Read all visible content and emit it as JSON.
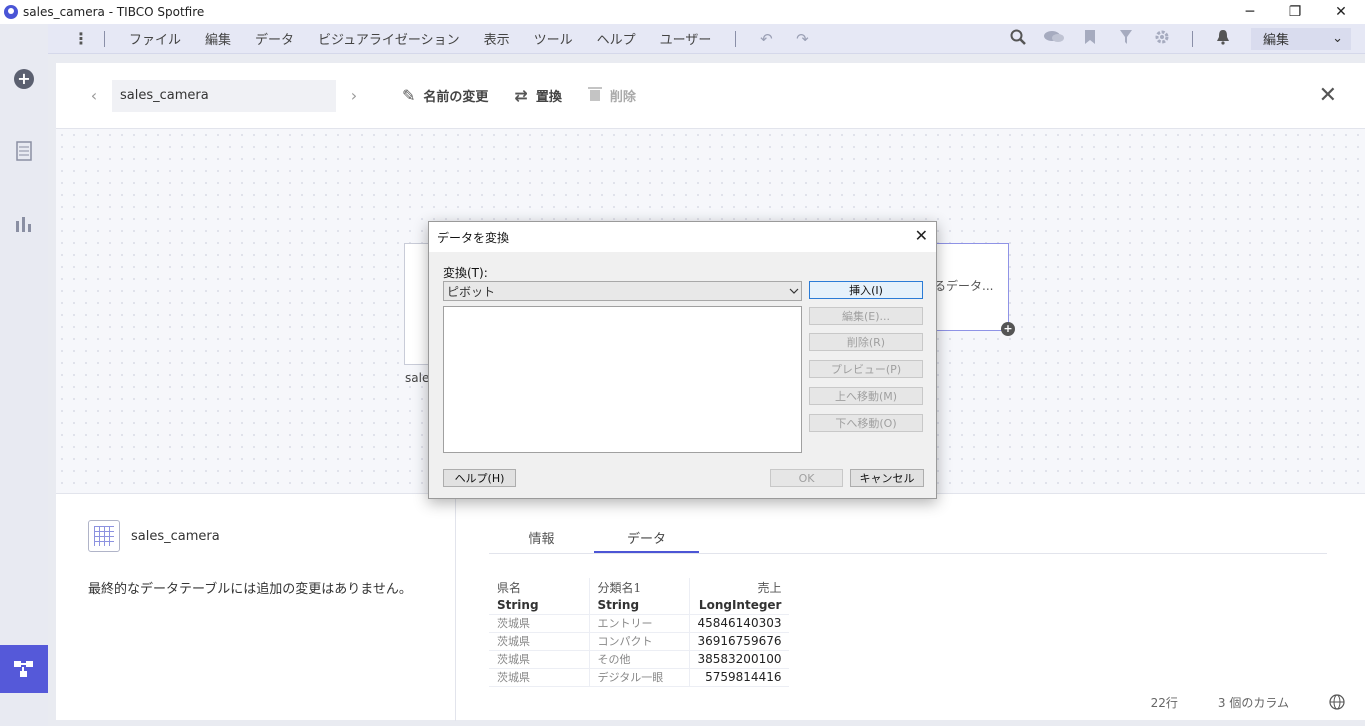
{
  "window": {
    "title": "sales_camera - TIBCO Spotfire",
    "min": "─",
    "restore": "❐",
    "close": "✕"
  },
  "menu": {
    "dots": "⋮",
    "items": [
      "ファイル",
      "編集",
      "データ",
      "ビジュアライゼーション",
      "表示",
      "ツール",
      "ヘルプ",
      "ユーザー"
    ],
    "undo": "↶",
    "redo": "↷",
    "mode": "編集",
    "mode_caret": "⌄"
  },
  "toolbar": {
    "prev": "‹",
    "next": "›",
    "table_name": "sales_camera",
    "rename": "名前の変更",
    "replace": "置換",
    "delete": "削除",
    "close": "✕"
  },
  "canvas": {
    "left_node_label": "sales",
    "right_node_label": "るデータ..."
  },
  "details": {
    "table_name": "sales_camera",
    "info_text": "最終的なデータテーブルには追加の変更はありません。",
    "tabs": [
      "情報",
      "データ"
    ],
    "columns": [
      {
        "name": "県名",
        "type": "String"
      },
      {
        "name": "分類名1",
        "type": "String"
      },
      {
        "name": "売上",
        "type": "LongInteger"
      }
    ],
    "rows": [
      [
        "茨城県",
        "エントリー",
        "45846140303"
      ],
      [
        "茨城県",
        "コンパクト",
        "36916759676"
      ],
      [
        "茨城県",
        "その他",
        "38583200100"
      ],
      [
        "茨城県",
        "デジタル一眼",
        "5759814416"
      ]
    ],
    "row_count": "22行",
    "column_count": "3 個のカラム"
  },
  "dialog": {
    "title": "データを変換",
    "transform_label": "変換(T):",
    "transform_value": "ピボット",
    "insert": "挿入(I)",
    "edit": "編集(E)...",
    "remove": "削除(R)",
    "preview": "プレビュー(P)",
    "move_up": "上へ移動(M)",
    "move_down": "下へ移動(O)",
    "help": "ヘルプ(H)",
    "ok": "OK",
    "cancel": "キャンセル",
    "close": "✕"
  }
}
